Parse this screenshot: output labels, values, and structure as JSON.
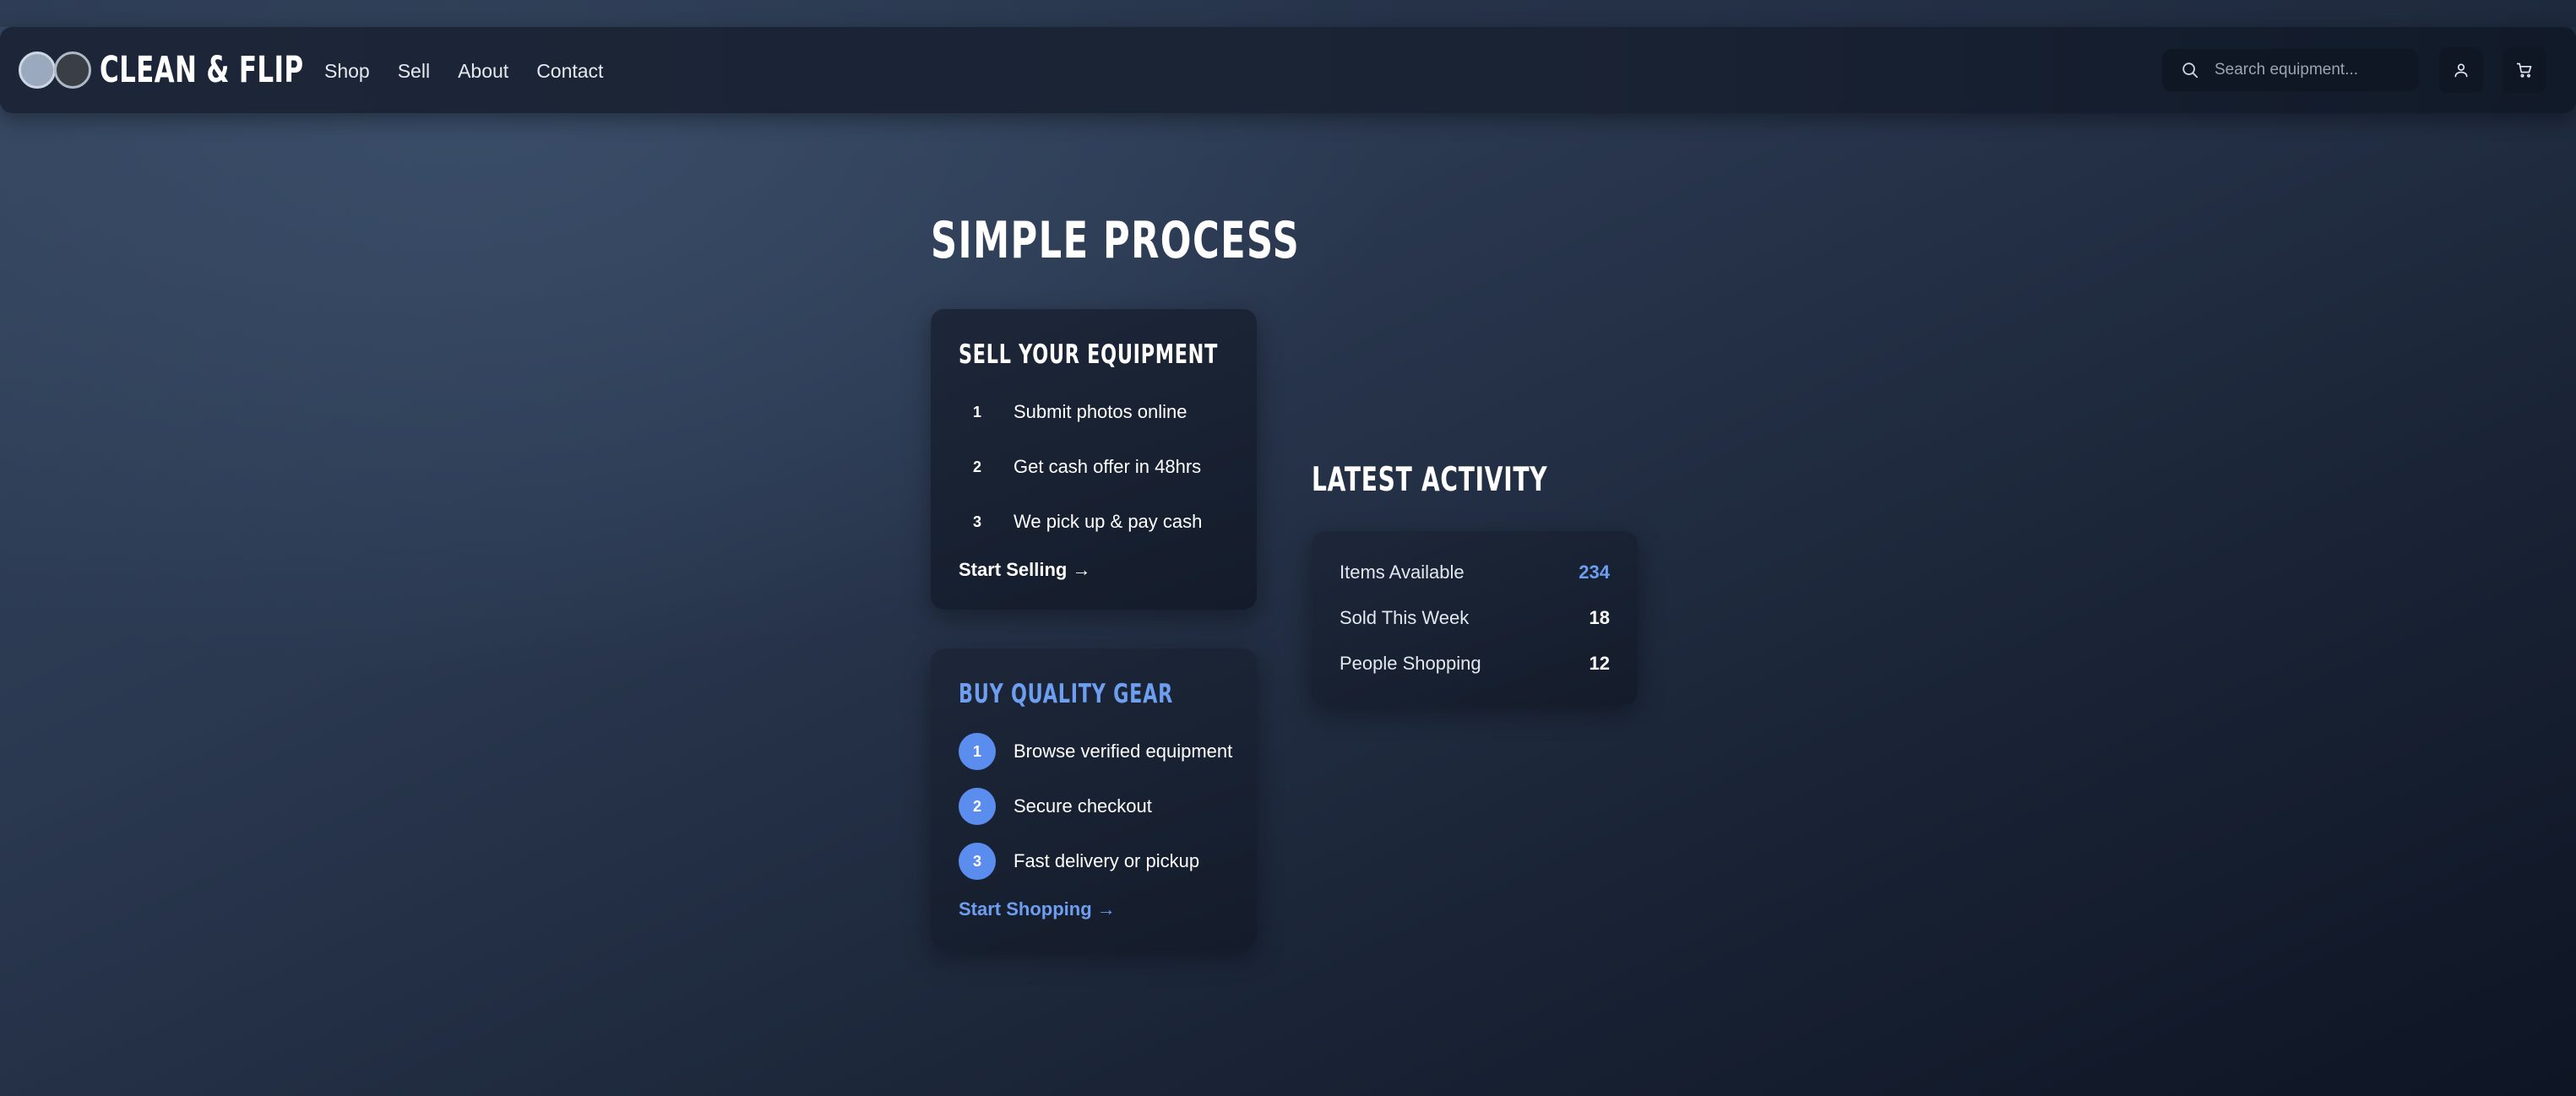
{
  "header": {
    "brand": "CLEAN & FLIP",
    "logo_icon": "double-circle-logo",
    "nav": [
      {
        "label": "Shop"
      },
      {
        "label": "Sell"
      },
      {
        "label": "About"
      },
      {
        "label": "Contact"
      }
    ],
    "search": {
      "placeholder": "Search equipment...",
      "icon": "search-icon"
    },
    "account_icon": "user-icon",
    "cart_icon": "cart-icon"
  },
  "process": {
    "title": "SIMPLE PROCESS",
    "sell": {
      "title": "SELL YOUR EQUIPMENT",
      "steps": [
        {
          "num": "1",
          "text": "Submit photos online"
        },
        {
          "num": "2",
          "text": "Get cash offer in 48hrs"
        },
        {
          "num": "3",
          "text": "We pick up & pay cash"
        }
      ],
      "cta": "Start Selling →"
    },
    "buy": {
      "title": "BUY QUALITY GEAR",
      "steps": [
        {
          "num": "1",
          "text": "Browse verified equipment"
        },
        {
          "num": "2",
          "text": "Secure checkout"
        },
        {
          "num": "3",
          "text": "Fast delivery or pickup"
        }
      ],
      "cta": "Start Shopping →"
    }
  },
  "activity": {
    "title": "LATEST ACTIVITY",
    "stats": [
      {
        "label": "Items Available",
        "value": "234"
      },
      {
        "label": "Sold This Week",
        "value": "18"
      },
      {
        "label": "People Shopping",
        "value": "12"
      }
    ]
  },
  "colors": {
    "accent": "#6d9ef0",
    "step_badge": "#5b8def",
    "card_bg": "#1a2334",
    "page_bg_dark": "#0e1524",
    "page_bg_light": "#34455e"
  }
}
